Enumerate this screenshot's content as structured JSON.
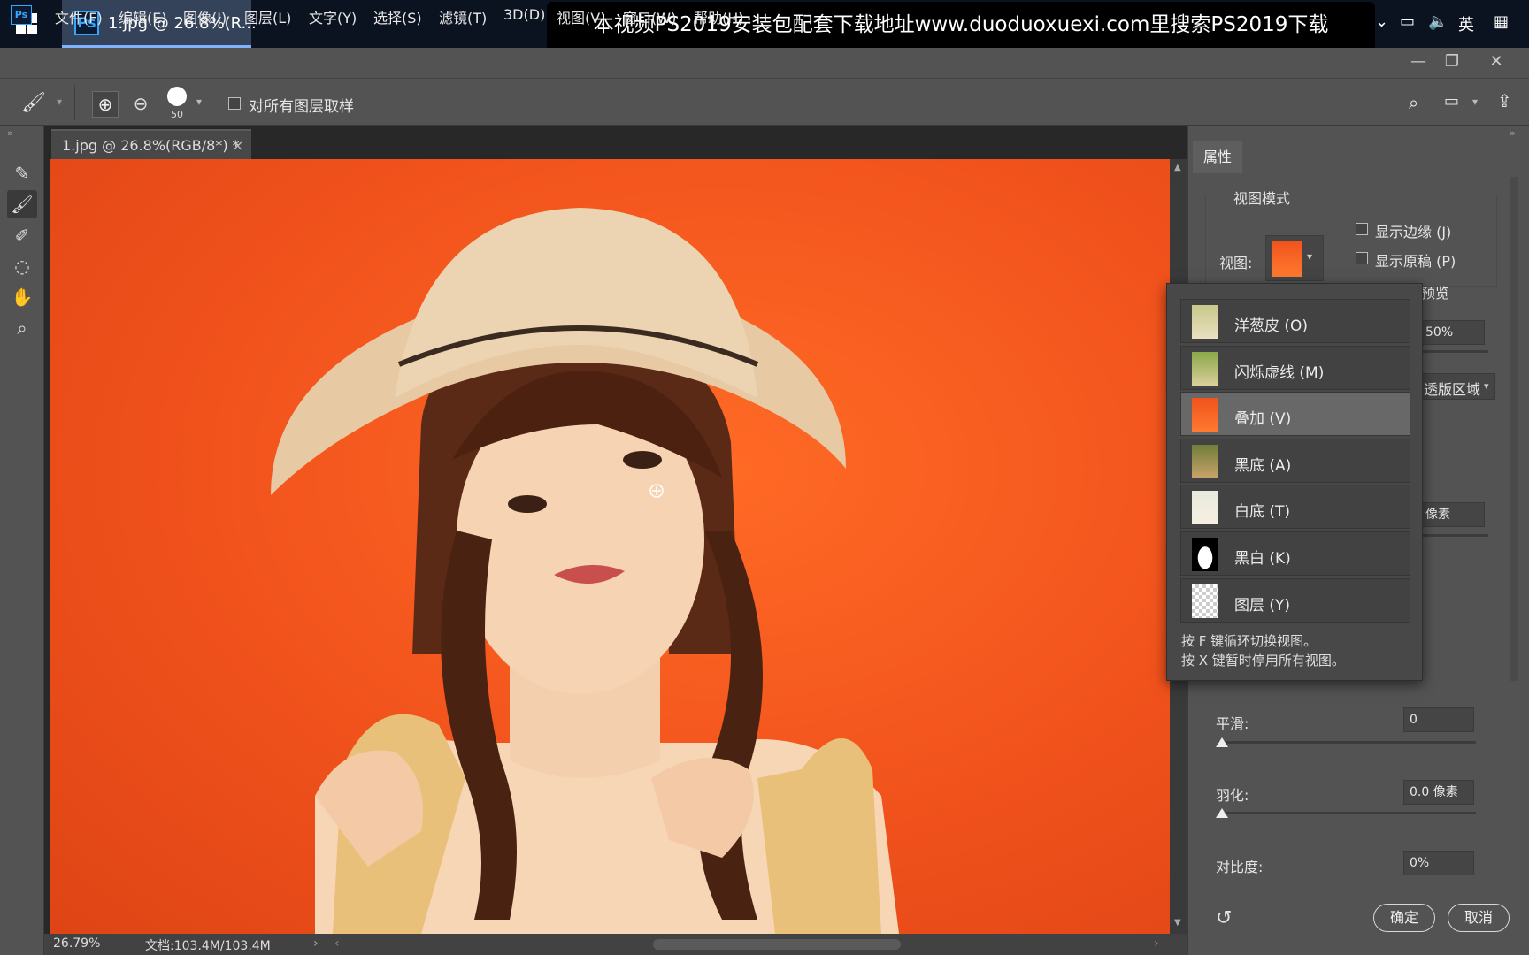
{
  "taskbar": {
    "active_task": "1.jpg @ 26.8%(R...",
    "banner": "本视频PS2019安装包配套下载地址www.duoduoxuexi.com里搜索PS2019下载",
    "ime": "英"
  },
  "menubar": {
    "items": [
      "文件(F)",
      "编辑(E)",
      "图像(I)",
      "图层(L)",
      "文字(Y)",
      "选择(S)",
      "滤镜(T)",
      "3D(D)",
      "视图(V)",
      "窗口(W)",
      "帮助(H)"
    ]
  },
  "optionsbar": {
    "brush_size": "50",
    "sample_all_layers": "对所有图层取样"
  },
  "document": {
    "tab_title": "1.jpg @ 26.8%(RGB/8*) *",
    "zoom": "26.79%",
    "doc_size": "文档:103.4M/103.4M"
  },
  "properties": {
    "tab": "属性",
    "view_mode_title": "视图模式",
    "view_label": "视图:",
    "show_edge": "显示边缘 (J)",
    "show_original": "显示原稿 (P)",
    "preview_partial": "预览",
    "opacity_value": "50%",
    "region_partial": "透版区域",
    "pixel_partial": "像素",
    "smooth_label": "平滑:",
    "smooth_value": "0",
    "feather_label": "羽化:",
    "feather_value": "0.0 像素",
    "contrast_label": "对比度:",
    "contrast_value": "0%",
    "ok": "确定",
    "cancel": "取消"
  },
  "view_menu": {
    "items": [
      {
        "label": "洋葱皮 (O)",
        "thumb": "onion",
        "selected": false
      },
      {
        "label": "闪烁虚线 (M)",
        "thumb": "marching",
        "selected": false
      },
      {
        "label": "叠加 (V)",
        "thumb": "overlay",
        "selected": true
      },
      {
        "label": "黑底 (A)",
        "thumb": "onblack",
        "selected": false
      },
      {
        "label": "白底 (T)",
        "thumb": "onwhite",
        "selected": false
      },
      {
        "label": "黑白 (K)",
        "thumb": "bw",
        "selected": false
      },
      {
        "label": "图层 (Y)",
        "thumb": "layer",
        "selected": false
      }
    ],
    "hint1": "按 F 键循环切换视图。",
    "hint2": "按 X 键暂时停用所有视图。"
  },
  "colors": {
    "canvas_bg": "#f1521c",
    "accent": "#31a8ff",
    "panel": "#535353"
  }
}
